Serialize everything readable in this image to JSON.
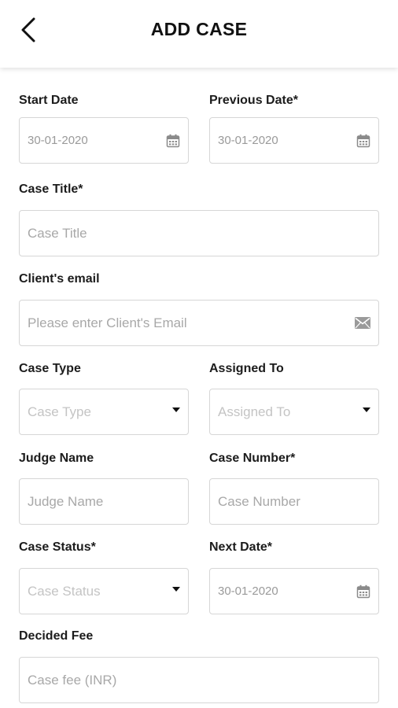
{
  "header": {
    "title": "ADD CASE"
  },
  "form": {
    "start_date": {
      "label": "Start Date",
      "value": "30-01-2020"
    },
    "previous_date": {
      "label": "Previous Date*",
      "value": "30-01-2020"
    },
    "case_title": {
      "label": "Case Title*",
      "placeholder": "Case Title"
    },
    "client_email": {
      "label": "Client's email",
      "placeholder": "Please enter Client's Email"
    },
    "case_type": {
      "label": "Case Type",
      "placeholder": "Case Type"
    },
    "assigned_to": {
      "label": "Assigned To",
      "placeholder": "Assigned To"
    },
    "judge_name": {
      "label": "Judge Name",
      "placeholder": "Judge Name"
    },
    "case_number": {
      "label": "Case Number*",
      "placeholder": "Case Number"
    },
    "case_status": {
      "label": "Case Status*",
      "placeholder": "Case Status"
    },
    "next_date": {
      "label": "Next Date*",
      "value": "30-01-2020"
    },
    "decided_fee": {
      "label": "Decided Fee",
      "placeholder": "Case fee (INR)"
    }
  },
  "icons": {
    "back": "chevron-left-icon",
    "date": "calendar-icon",
    "email": "envelope-icon",
    "dropdown": "caret-down-icon"
  },
  "colors": {
    "border": "#d6d6d6",
    "placeholder": "#a8a8a8",
    "label": "#1c1c1c",
    "icon": "#8a8a8a"
  }
}
